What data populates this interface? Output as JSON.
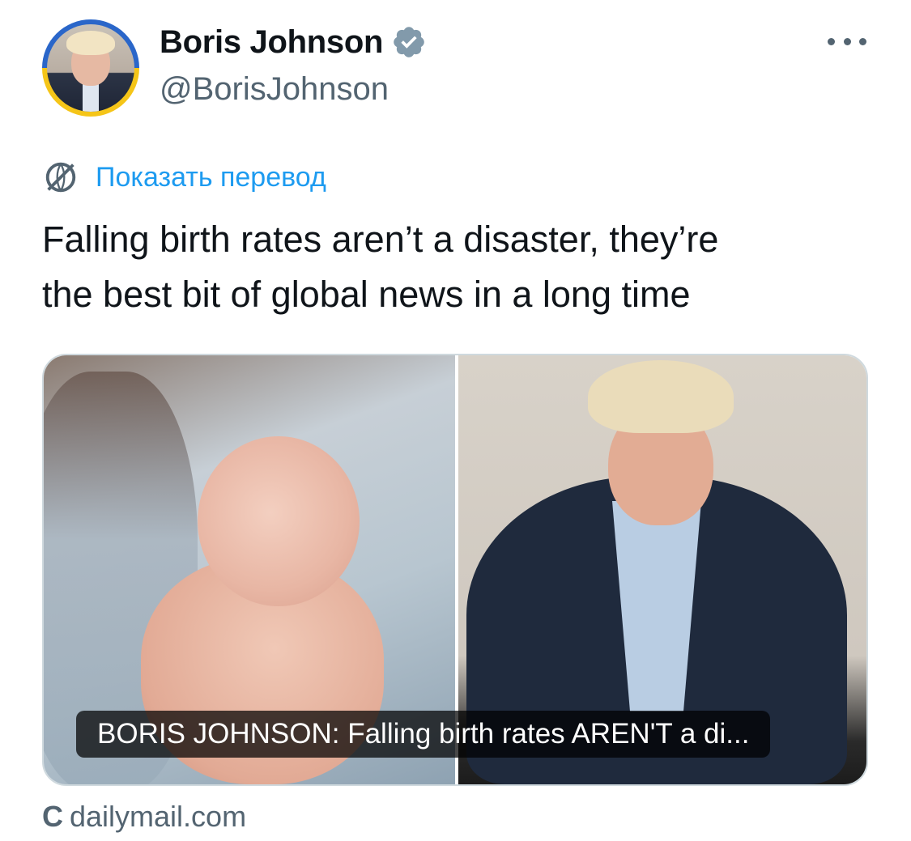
{
  "author": {
    "display_name": "Boris Johnson",
    "handle": "@BorisJohnson",
    "avatar_icon": "avatar-photo"
  },
  "translate": {
    "label": "Показать перевод",
    "icon": "translate-globe-icon"
  },
  "tweet": {
    "text": "Falling birth rates aren’t a disaster, they’re\nthe best bit of global news in a long time"
  },
  "card": {
    "caption": "BORIS JOHNSON: Falling birth rates AREN'T a di...",
    "source_icon_glyph": "C",
    "source_domain": "dailymail.com"
  },
  "colors": {
    "accent": "#1d9bf0",
    "secondary_text": "#536471",
    "verified": "#829aab"
  }
}
